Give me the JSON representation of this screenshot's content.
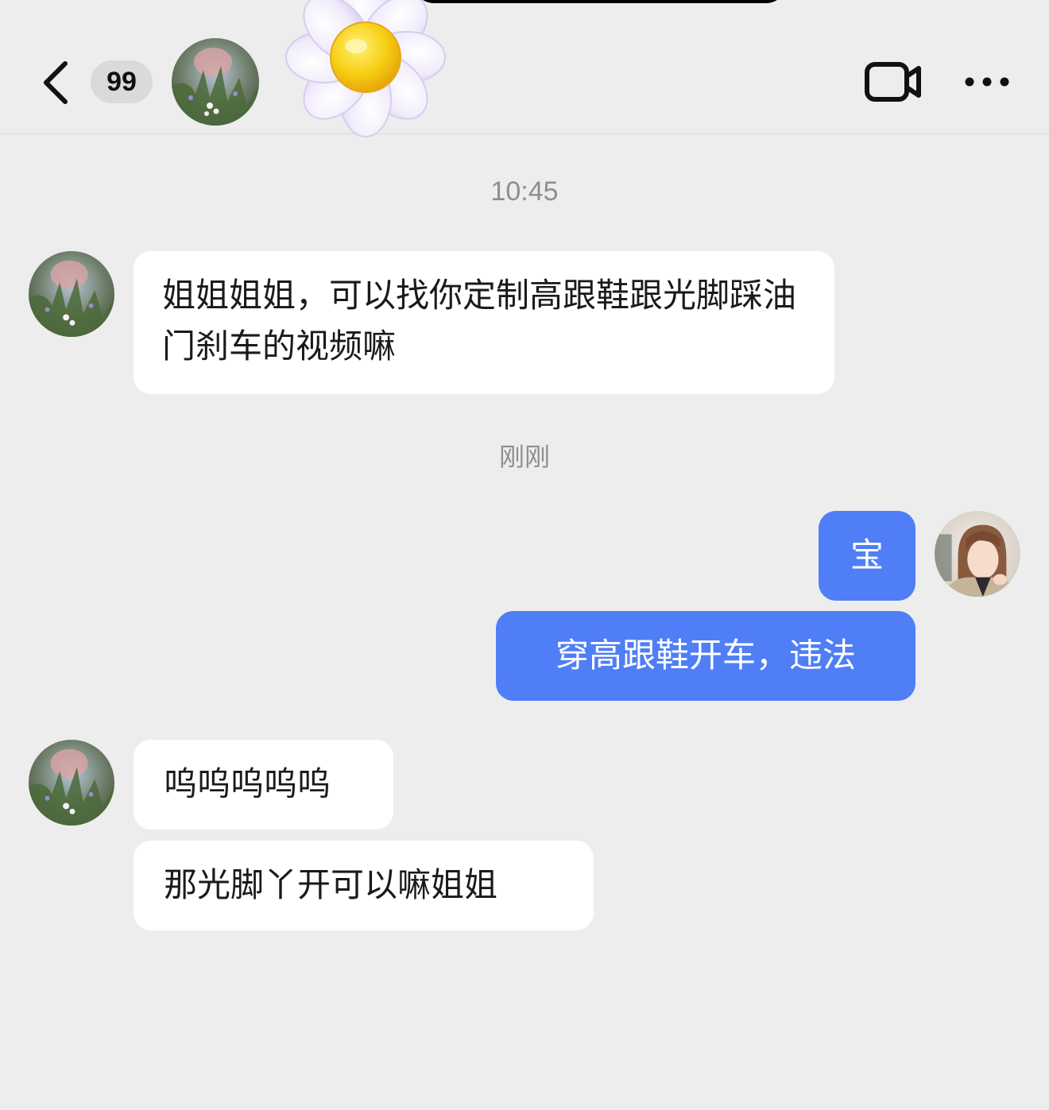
{
  "header": {
    "unread_count": "99"
  },
  "messages": [
    {
      "type": "timestamp",
      "text": "10:45"
    },
    {
      "type": "incoming",
      "text": "姐姐姐姐，可以找你定制高跟鞋跟光脚踩油门刹车的视频嘛"
    },
    {
      "type": "timestamp",
      "text": "刚刚"
    },
    {
      "type": "outgoing",
      "text": "宝"
    },
    {
      "type": "outgoing",
      "text": "穿高跟鞋开车，违法"
    },
    {
      "type": "incoming",
      "text": "呜呜呜呜呜"
    },
    {
      "type": "incoming",
      "text": "那光脚丫开可以嘛姐姐"
    }
  ],
  "colors": {
    "background": "#ededed",
    "incoming_bubble": "#ffffff",
    "outgoing_bubble": "#4f7ef6",
    "timestamp_text": "#8e8e8e"
  },
  "icons": {
    "back": "chevron-left-icon",
    "video": "video-camera-icon",
    "more": "ellipsis-icon",
    "sticker": "daisy-flower-sticker"
  }
}
